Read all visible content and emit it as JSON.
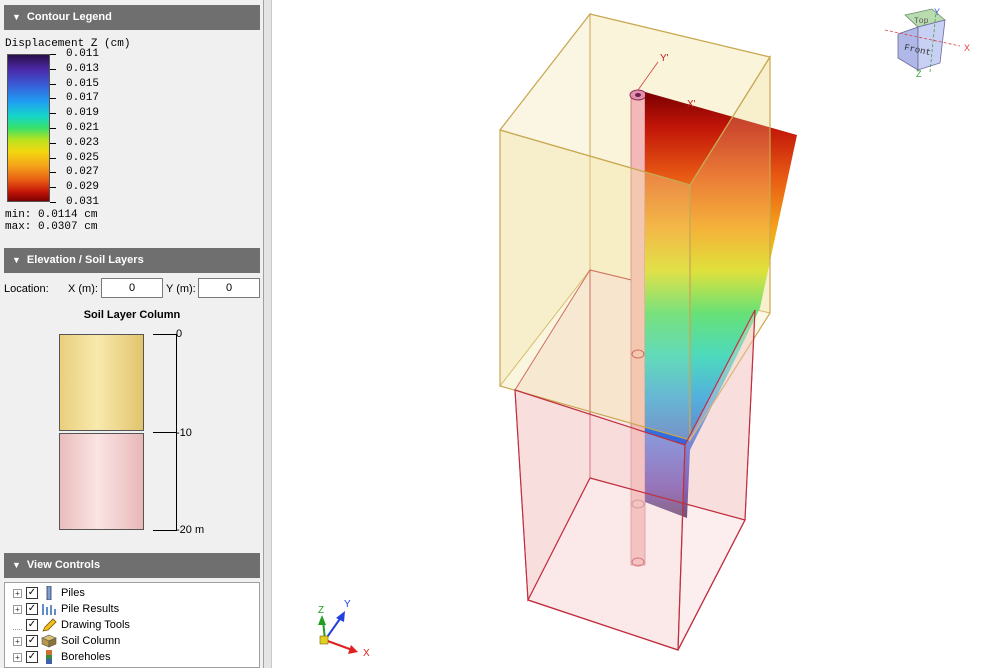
{
  "panels": {
    "contour_legend": {
      "header": "Contour Legend",
      "title": "Displacement Z (cm)",
      "ticks": [
        "0.011",
        "0.013",
        "0.015",
        "0.017",
        "0.019",
        "0.021",
        "0.023",
        "0.025",
        "0.027",
        "0.029",
        "0.031"
      ],
      "min": "min: 0.0114 cm",
      "max": "max: 0.0307 cm"
    },
    "elevation": {
      "header": "Elevation / Soil Layers",
      "location_label": "Location:",
      "x_label": "X (m):",
      "x_value": "0",
      "y_label": "Y (m):",
      "y_value": "0",
      "column_title": "Soil Layer Column",
      "scale": [
        "0",
        "-10",
        "-20 m"
      ]
    },
    "view_controls": {
      "header": "View Controls",
      "items": [
        "Piles",
        "Pile Results",
        "Drawing Tools",
        "Soil Column",
        "Boreholes"
      ]
    }
  },
  "viewport": {
    "nav_cube": {
      "top": "Top",
      "front": "Front",
      "x": "X",
      "y": "Y",
      "z": "Z"
    },
    "local_axes": {
      "x": "X'",
      "y": "Y'"
    },
    "triad": {
      "x": "X",
      "y": "Y",
      "z": "Z"
    }
  },
  "colors": {
    "panel_header": "#6f6f6f",
    "soil_upper": "#f2e2a0",
    "soil_lower": "#f6cece",
    "box_edge_upper": "#c8a850",
    "box_edge_lower": "#c03040"
  }
}
